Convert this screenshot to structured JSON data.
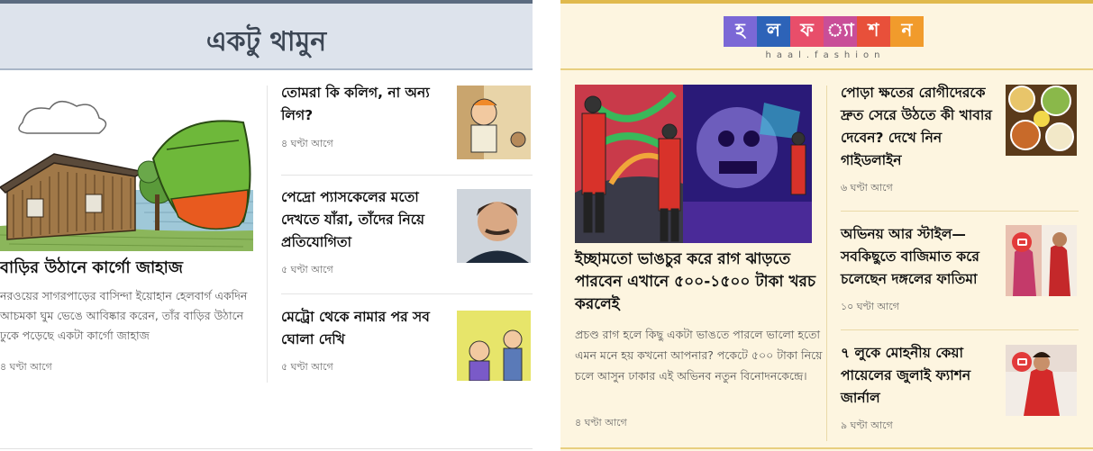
{
  "left": {
    "section_title": "একটু থামুন",
    "lead": {
      "title": "বাড়ির উঠানে কার্গো জাহাজ",
      "summary": "নরওয়ের সাগরপাড়ের বাসিন্দা ইয়োহান হেলবার্গ একদিন আচমকা ঘুম ভেঙে আবিষ্কার করেন, তাঁর বাড়ির উঠানে ঢুকে পড়েছে একটা কার্গো জাহাজ",
      "time": "৪ ঘণ্টা আগে"
    },
    "items": [
      {
        "title": "তোমরা কি কলিগ, না অন্য লিগ?",
        "time": "৪ ঘণ্টা আগে"
      },
      {
        "title": "পেদ্রো প্যাসকেলের মতো দেখতে যাঁরা, তাঁদের নিয়ে প্রতিযোগিতা",
        "time": "৫ ঘণ্টা আগে"
      },
      {
        "title": "মেট্রো থেকে নামার পর সব ঘোলা দেখি",
        "time": "৫ ঘণ্টা আগে"
      }
    ]
  },
  "right": {
    "logo": {
      "letters": [
        "হ",
        "া",
        "ল",
        "ফ",
        "্যা",
        "শ",
        "ন"
      ],
      "colors": [
        "#7b68d6",
        "#7b68d6",
        "#2d63b8",
        "#e84e6a",
        "#c94e98",
        "#e8503a",
        "#f19b2c"
      ],
      "subtitle": "haal.fashion"
    },
    "lead": {
      "title": "ইচ্ছামতো ভাঙচুর করে রাগ ঝাড়তে পারবেন এখানে ৫০০-১৫০০ টাকা খরচ করলেই",
      "summary": "প্রচণ্ড রাগ হলে কিছু একটা ভাঙতে পারলে ভালো হতো এমন মনে হয় কখনো আপনার? পকেটে ৫০০ টাকা নিয়ে চলে আসুন ঢাকার এই অভিনব নতুন বিনোদনকেন্দ্রে।",
      "time": "৪ ঘণ্টা আগে"
    },
    "items": [
      {
        "title": "পোড়া ক্ষতের রোগীদেরকে দ্রুত সেরে উঠতে কী খাবার দেবেন? দেখে নিন গাইডলাইন",
        "time": "৬ ঘণ্টা আগে"
      },
      {
        "title": "অভিনয় আর স্টাইল— সবকিছুতে বাজিমাত করে চলেছেন দঙ্গলের ফাতিমা",
        "time": "১০ ঘণ্টা আগে"
      },
      {
        "title": "৭ লুকে মোহনীয় কেয়া পায়েলের জুলাই ফ্যাশন জার্নাল",
        "time": "৯ ঘণ্টা আগে"
      }
    ]
  }
}
